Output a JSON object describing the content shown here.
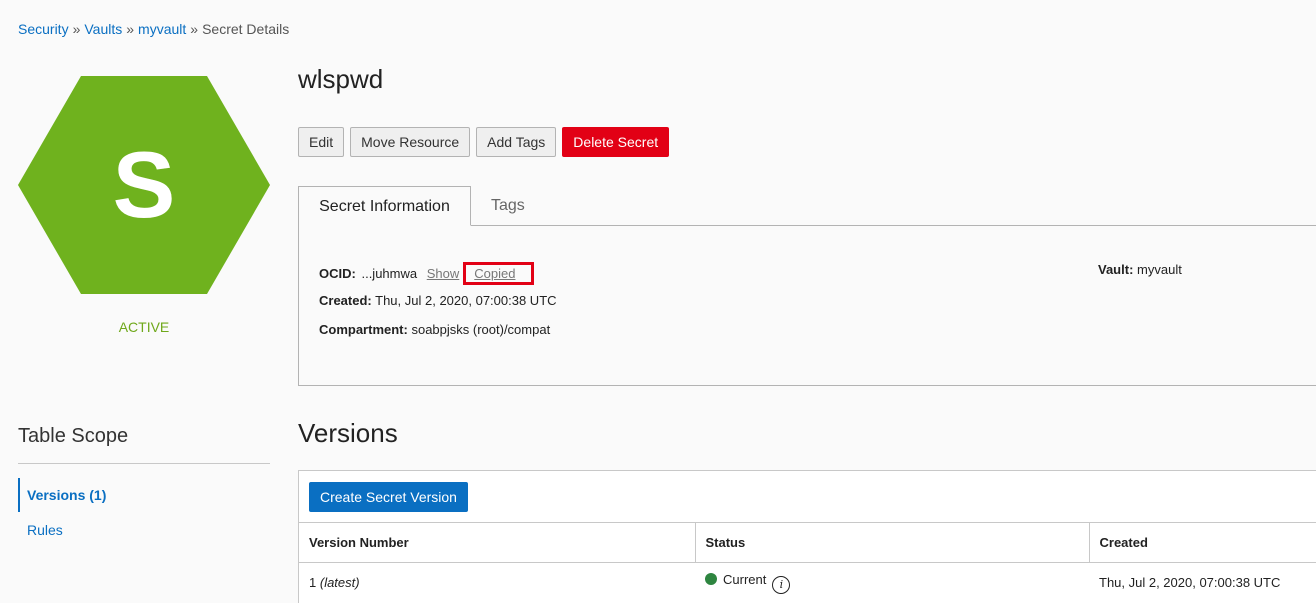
{
  "breadcrumb": {
    "items": [
      "Security",
      "Vaults",
      "myvault"
    ],
    "current": "Secret Details",
    "separator": "»"
  },
  "resource": {
    "initial": "S",
    "state": "ACTIVE",
    "badge_color": "#6fb21e"
  },
  "table_scope": {
    "title": "Table Scope",
    "items": [
      {
        "label": "Versions (1)",
        "active": true
      },
      {
        "label": "Rules",
        "active": false
      }
    ]
  },
  "header": {
    "title": "wlspwd"
  },
  "actions": {
    "edit": "Edit",
    "move": "Move Resource",
    "tags": "Add Tags",
    "delete": "Delete Secret"
  },
  "tabs": {
    "info": "Secret Information",
    "tags": "Tags"
  },
  "info": {
    "ocid_label": "OCID:",
    "ocid_value": "...juhmwa",
    "show": "Show",
    "copied": "Copied",
    "created_label": "Created:",
    "created_value": "Thu, Jul 2, 2020, 07:00:38 UTC",
    "compartment_label": "Compartment:",
    "compartment_value": "soabpjsks (root)/compat",
    "vault_label": "Vault:",
    "vault_value": "myvault"
  },
  "versions": {
    "title": "Versions",
    "create_button": "Create Secret Version",
    "columns": [
      "Version Number",
      "Status",
      "Created"
    ],
    "rows": [
      {
        "number": "1",
        "tag": "(latest)",
        "status": "Current",
        "created": "Thu, Jul 2, 2020, 07:00:38 UTC"
      }
    ]
  },
  "colors": {
    "link": "#0a6fc2",
    "danger": "#e20015",
    "active_state": "#6fa81b",
    "status_current": "#2e8540"
  }
}
